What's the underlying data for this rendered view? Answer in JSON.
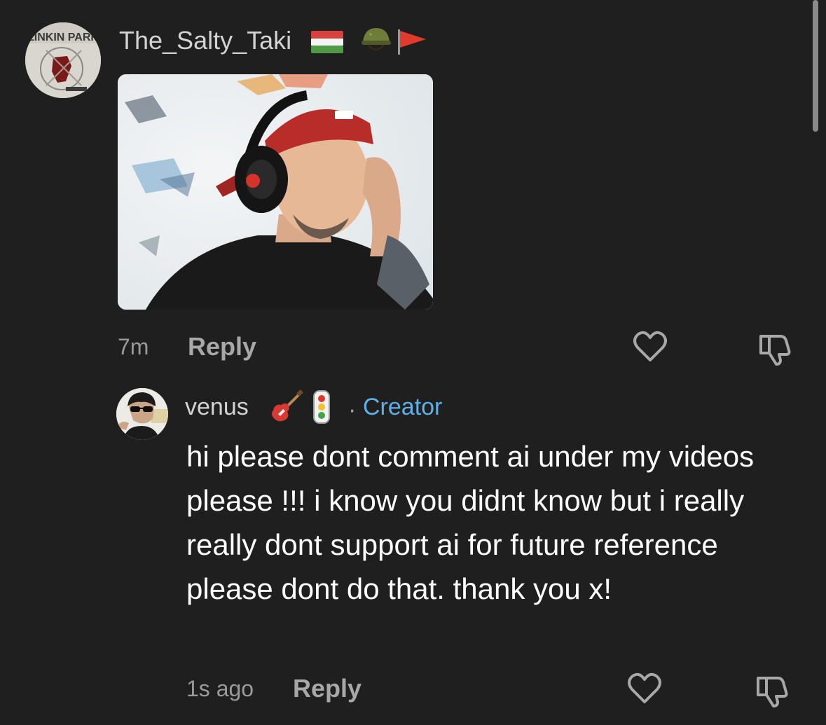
{
  "comment_1": {
    "username": "The_Salty_Taki",
    "avatar_icon": "album-cover-avatar",
    "avatar_text": "LINKIN PARK",
    "badges": [
      "hungary-flag-icon",
      "military-helmet-icon",
      "red-flag-icon"
    ],
    "attachment_icon": "photo-attachment",
    "time": "7m",
    "reply_label": "Reply",
    "like_icon": "heart-icon",
    "dislike_icon": "thumbs-down-icon"
  },
  "comment_2": {
    "username": "venus",
    "avatar_icon": "user-avatar",
    "badges": [
      "guitar-icon",
      "traffic-light-icon"
    ],
    "separator": "·",
    "creator_label": "Creator",
    "text": "hi please dont comment ai under my videos please !!! i know you didnt know but i really really dont support ai for future reference please dont do that. thank you x!",
    "time": "1s ago",
    "reply_label": "Reply",
    "like_icon": "heart-icon",
    "dislike_icon": "thumbs-down-icon"
  },
  "colors": {
    "background": "#1f1f1f",
    "creator": "#5eb1e6",
    "muted_text": "#9a9a9a",
    "username": "#d3d3d3"
  }
}
